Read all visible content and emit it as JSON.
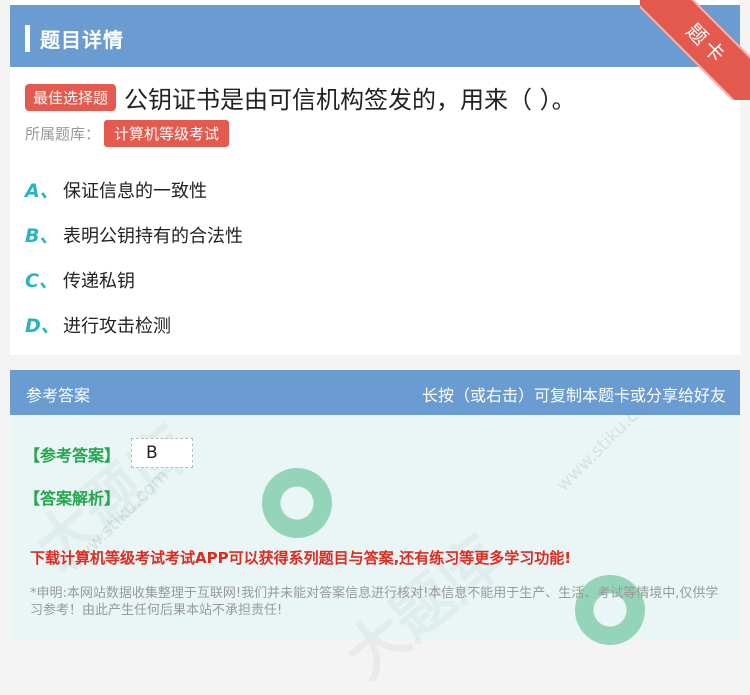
{
  "header": {
    "title": "题目详情",
    "ribbon": "题卡"
  },
  "question": {
    "type_tag": "最佳选择题",
    "text": "公钥证书是由可信机构签发的，用来（ ）。",
    "bank_label": "所属题库：",
    "bank_name": "计算机等级考试"
  },
  "options": [
    {
      "letter": "A、",
      "text": "保证信息的一致性"
    },
    {
      "letter": "B、",
      "text": "表明公钥持有的合法性"
    },
    {
      "letter": "C、",
      "text": "传递私钥"
    },
    {
      "letter": "D、",
      "text": "进行攻击检测"
    }
  ],
  "answer_section": {
    "title": "参考答案",
    "hint": "长按（或右击）可复制本题卡或分享给好友",
    "answer_label": "【参考答案】",
    "answer_value": "B",
    "analysis_label": "【答案解析】",
    "promo": "下载计算机等级考试考试APP可以获得系列题目与答案,还有练习等更多学习功能!",
    "disclaimer": "*申明:本网站数据收集整理于互联网!我们并未能对答案信息进行核对!本信息不能用于生产、生活、考试等情境中,仅供学习参考！由此产生任何后果本站不承担责任!"
  },
  "watermark": {
    "brand": "大题库",
    "url": "www.stiku.com"
  },
  "colors": {
    "header_blue": "#6b9cd1",
    "tag_red": "#e45a4f",
    "option_letter": "#2ab3c4",
    "answer_green": "#27a64f",
    "promo_red": "#e02a20"
  }
}
